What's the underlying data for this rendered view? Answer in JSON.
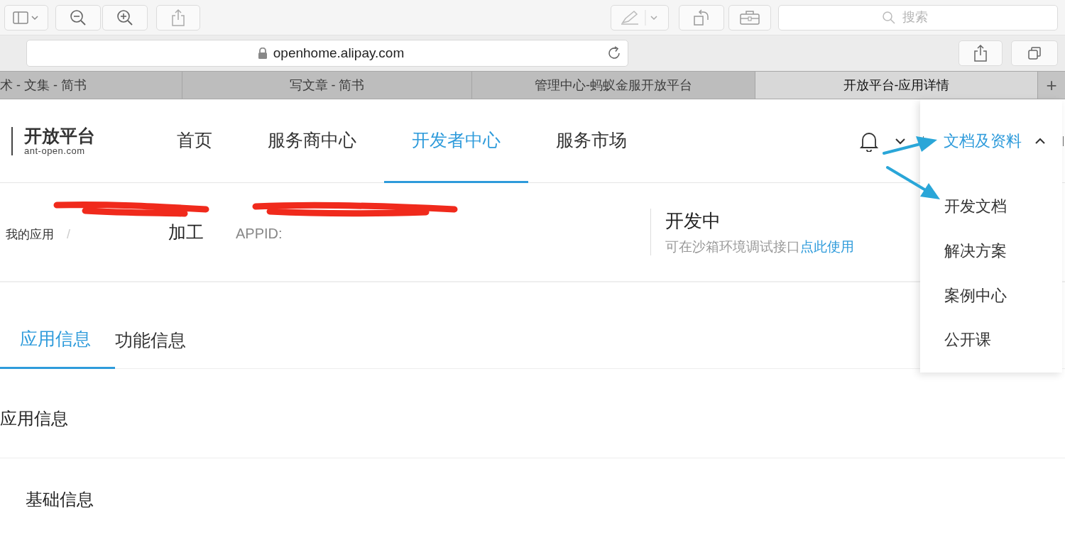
{
  "toolbar": {
    "search": {
      "placeholder": "搜索"
    }
  },
  "address_bar": {
    "url": "openhome.alipay.com"
  },
  "browser_tabs": [
    {
      "title": "术 - 文集 - 简书",
      "selected": false
    },
    {
      "title": "写文章 - 简书",
      "selected": false
    },
    {
      "title": "管理中心-蚂蚁金服开放平台",
      "selected": false
    },
    {
      "title": "开放平台-应用详情",
      "selected": true
    }
  ],
  "new_tab": "+",
  "site_header": {
    "logo_title": "开放平台",
    "logo_subtitle": "ant-open.com",
    "nav": [
      {
        "label": "首页",
        "selected": false
      },
      {
        "label": "服务商中心",
        "selected": false
      },
      {
        "label": "开发者中心",
        "selected": true
      },
      {
        "label": "服务市场",
        "selected": false
      }
    ],
    "docs_menu": {
      "label": "文档及资料",
      "expanded": true,
      "items": [
        "开发文档",
        "解决方案",
        "案例中心",
        "公开课"
      ]
    }
  },
  "breadcrumb": {
    "parent": "我的应用",
    "separator": "/",
    "current": "加工",
    "appid": "APPID:"
  },
  "status": {
    "title": "开发中",
    "hint": "可在沙箱环境调试接口",
    "link": "点此使用"
  },
  "tabs": [
    {
      "label": "应用信息",
      "selected": true
    },
    {
      "label": "功能信息",
      "selected": false
    }
  ],
  "section_title": "应用信息",
  "subsection_title": "基础信息"
}
